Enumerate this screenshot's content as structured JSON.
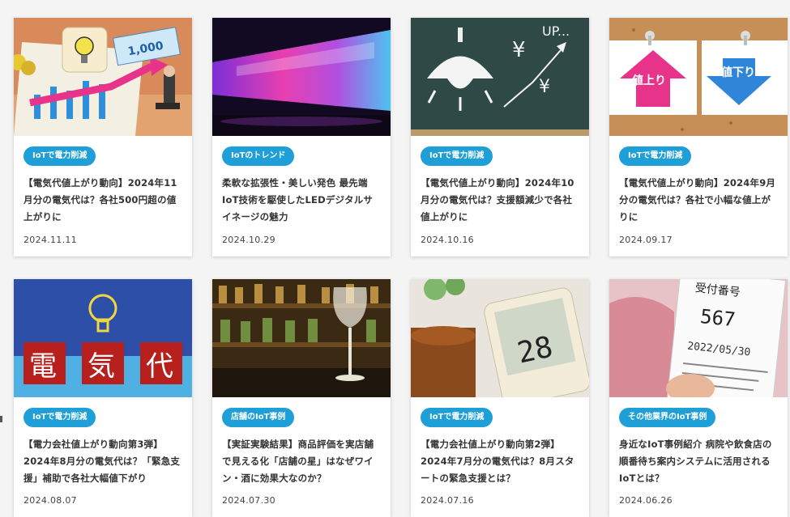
{
  "cards": [
    {
      "tag": "IoTで電力削減",
      "title": "【電気代値上がり動向】2024年11月分の電気代は？各社500円超の値上がりに",
      "date": "2024.11.11",
      "image_text": "1,000"
    },
    {
      "tag": "IoTのトレンド",
      "title": "柔軟な拡張性・美しい発色 最先端IoT技術を駆使したLEDデジタルサイネージの魅力",
      "date": "2024.10.29"
    },
    {
      "tag": "IoTで電力削減",
      "title": "【電気代値上がり動向】2024年10月分の電気代は？支援額減少で各社値上がりに",
      "date": "2024.10.16",
      "image_text": "UP..."
    },
    {
      "tag": "IoTで電力削減",
      "title": "【電気代値上がり動向】2024年9月分の電気代は？各社で小幅な値上がりに",
      "date": "2024.09.17",
      "image_labels": [
        "値上り",
        "値下り"
      ]
    },
    {
      "tag": "IoTで電力削減",
      "title": "【電力会社値上がり動向第3弾】2024年8月分の電気代は？「緊急支援」補助で各社大幅値下がり",
      "date": "2024.08.07",
      "image_chars": [
        "電",
        "気",
        "代"
      ]
    },
    {
      "tag": "店舗のIoT事例",
      "title": "【実証実験結果】商品評価を実店舗で見える化「店舗の星」はなぜワイン・酒に効果大なのか？",
      "date": "2024.07.30"
    },
    {
      "tag": "IoTで電力削減",
      "title": "【電力会社値上がり動向第2弾】2024年7月分の電気代は？8月スタートの緊急支援とは？",
      "date": "2024.07.16",
      "image_text": "28"
    },
    {
      "tag": "その他業界のIoT事例",
      "title": "身近なIoT事例紹介 病院や飲食店の順番待ち案内システムに活用されるIoTとは？",
      "date": "2024.06.26",
      "image_lines": [
        "受付番号",
        "567",
        "2022/05/30"
      ]
    }
  ]
}
